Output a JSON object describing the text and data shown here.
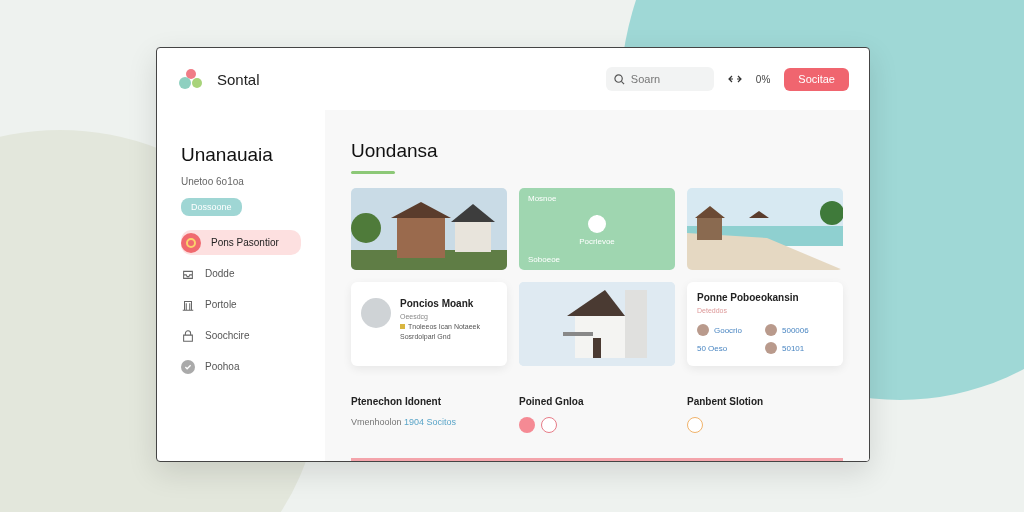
{
  "header": {
    "brand": "Sontal",
    "search": {
      "placeholder": "Soarn"
    },
    "status": "0%",
    "button": "Socitae"
  },
  "sidebar": {
    "title": "Unanauaia",
    "subtitle": "Unetoo 6o1oa",
    "tag": "Dossoone",
    "items": [
      {
        "label": "Pons Pasontior",
        "selected": true
      },
      {
        "label": "Dodde",
        "selected": false
      },
      {
        "label": "Portole",
        "selected": false
      },
      {
        "label": "Soochcire",
        "selected": false
      },
      {
        "label": "Poohoa",
        "selected": false
      }
    ]
  },
  "main": {
    "title": "Uondansa",
    "feature_card": {
      "top": "Mosnoe",
      "center": "Pocrlevoe",
      "bottom": "Soboeoe"
    },
    "profile_card": {
      "name": "Poncios Moank",
      "role": "Oeesdcg",
      "line_1": "Tnoleeos Ican Notaeek",
      "line_2": "Sosrdolparl Gnd"
    },
    "members_card": {
      "title": "Ponne Poboeokansin",
      "subtitle": "Deteddos",
      "members": [
        {
          "label": "Goocrio",
          "avatar": true
        },
        {
          "label": "500006",
          "avatar": true
        },
        {
          "label": "50 Oeso",
          "avatar": false
        },
        {
          "label": "50101",
          "avatar": true
        }
      ]
    },
    "sections": [
      {
        "kind": "text",
        "title": "Ptenechon Idonent",
        "text": "Vmenhoolon",
        "link": "1904 Socitos"
      },
      {
        "kind": "icons",
        "title": "Poined Gnloa"
      },
      {
        "kind": "circle",
        "title": "Panbent Slotion"
      }
    ]
  }
}
